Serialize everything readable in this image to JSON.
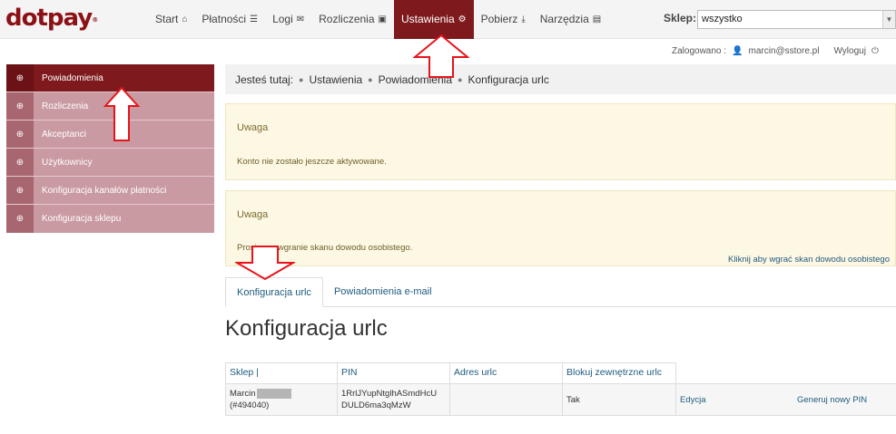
{
  "header": {
    "logo_text": "dotpay",
    "logo_mark": "®",
    "nav": [
      {
        "label": "Start",
        "icon": "home-icon"
      },
      {
        "label": "Płatności",
        "icon": "list-icon"
      },
      {
        "label": "Logi",
        "icon": "envelope-icon"
      },
      {
        "label": "Rozliczenia",
        "icon": "money-icon"
      },
      {
        "label": "Ustawienia",
        "icon": "cogs-icon",
        "active": true
      },
      {
        "label": "Pobierz",
        "icon": "download-icon"
      },
      {
        "label": "Narzędzia",
        "icon": "briefcase-icon"
      }
    ],
    "shop_label": "Sklep:",
    "shop_value": "wszystko"
  },
  "userbar": {
    "logged_label": "Zalogowano :",
    "user": "marcin@sstore.pl",
    "logout": "Wyloguj"
  },
  "sidebar": {
    "items": [
      {
        "label": "Powiadomienia",
        "active": true
      },
      {
        "label": "Rozliczenia"
      },
      {
        "label": "Akceptanci"
      },
      {
        "label": "Użytkownicy"
      },
      {
        "label": "Konfiguracja kanałów płatności"
      },
      {
        "label": "Konfiguracja sklepu"
      }
    ]
  },
  "breadcrumb": {
    "prefix": "Jesteś tutaj:",
    "items": [
      "Ustawienia",
      "Powiadomienia",
      "Konfiguracja urlc"
    ]
  },
  "alerts": [
    {
      "title": "Uwaga",
      "text": "Konto nie zostało jeszcze aktywowane."
    },
    {
      "title": "Uwaga",
      "text": "Prosimy o wgranie skanu dowodu osobistego.",
      "link": "Kliknij aby wgrać skan dowodu osobistego"
    }
  ],
  "tabs": [
    "Konfiguracja urlc",
    "Powiadomienia e-mail"
  ],
  "page_title": "Konfiguracja urlc",
  "table": {
    "headers": [
      "Sklep |",
      "PIN",
      "Adres urlc",
      "Blokuj zewnętrzne urlc"
    ],
    "row": {
      "shop_name": "Marcin",
      "shop_id": "(#494040)",
      "pin_line1": "1RrlJYupNtglhASmdHcU",
      "pin_line2": "DULD6ma3qMzW",
      "urlc": "",
      "block": "Tak",
      "edit": "Edycja",
      "generate": "Generuj nowy PIN"
    }
  },
  "colors": {
    "brand": "#7e1a1d",
    "sidebar_bg": "#c99aa1",
    "alert_bg": "#fcf8e3",
    "link": "#1e5b7e",
    "annotation_arrow": "#e8131b"
  }
}
